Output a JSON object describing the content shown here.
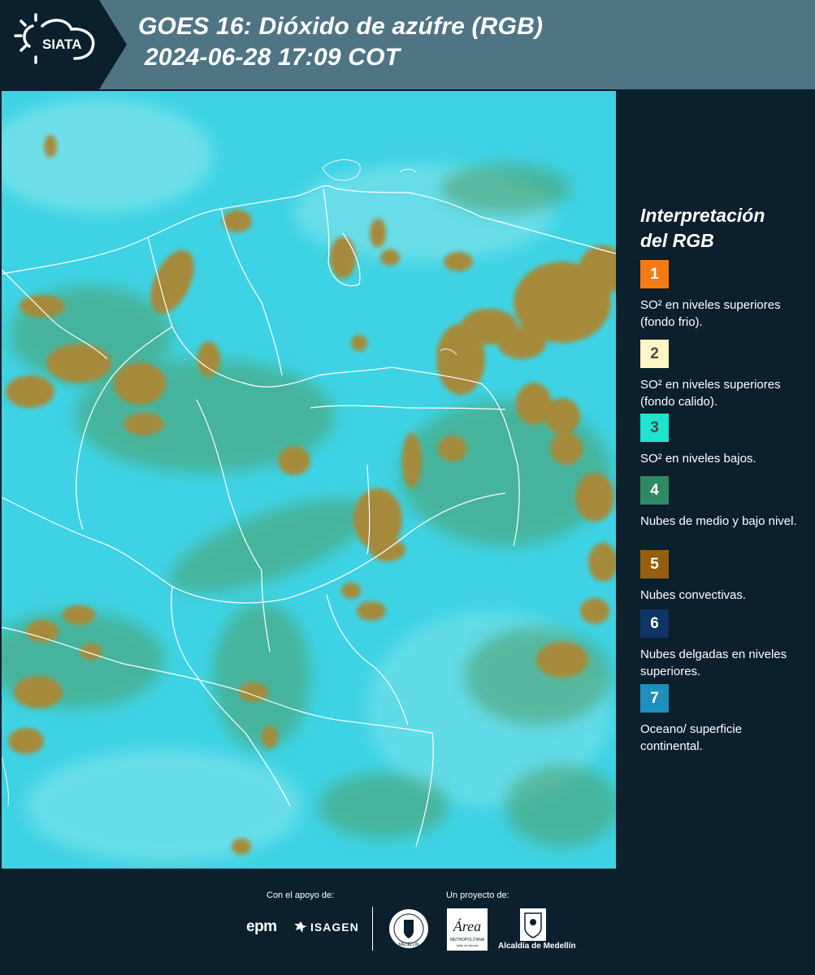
{
  "header": {
    "logo_text": "SIATA",
    "title_line1": "GOES 16: Dióxido de azúfre (RGB)",
    "title_line2": "2024-06-28 17:09 COT"
  },
  "legend": {
    "title_line1": "Interpretación",
    "title_line2": "del RGB",
    "items": [
      {
        "number": "1",
        "color": "#f47b13",
        "text": "SO² en niveles superiores (fondo frio)."
      },
      {
        "number": "2",
        "color": "#fdf6c4",
        "text": "SO² en niveles superiores (fondo calido)."
      },
      {
        "number": "3",
        "color": "#1fe3cc",
        "text": "SO² en niveles bajos."
      },
      {
        "number": "4",
        "color": "#2f8a63",
        "text": "Nubes de medio y bajo nivel."
      },
      {
        "number": "5",
        "color": "#94600f",
        "text": "Nubes convectivas."
      },
      {
        "number": "6",
        "color": "#0f3466",
        "text": "Nubes delgadas en niveles superiores."
      },
      {
        "number": "7",
        "color": "#1f8fbb",
        "text": "Oceano/ superficie continental."
      }
    ]
  },
  "footer": {
    "support_label": "Con el apoyo de:",
    "project_label": "Un proyecto de:",
    "epm_text": "epm",
    "isagen_text": "ISAGEN",
    "area_text": "Área",
    "area_subtext": "METROPOLITANA",
    "area_subtext2": "Valle de Aburrá",
    "alcaldia_text": "Alcaldía de Medellín",
    "seal_text": "MEDELLÍN"
  },
  "map": {
    "ocean_color": "#3fd6e6",
    "cloud_color": "#a4883a",
    "cloud_edge_color": "#5b8f59",
    "border_color": "#ffffff"
  }
}
